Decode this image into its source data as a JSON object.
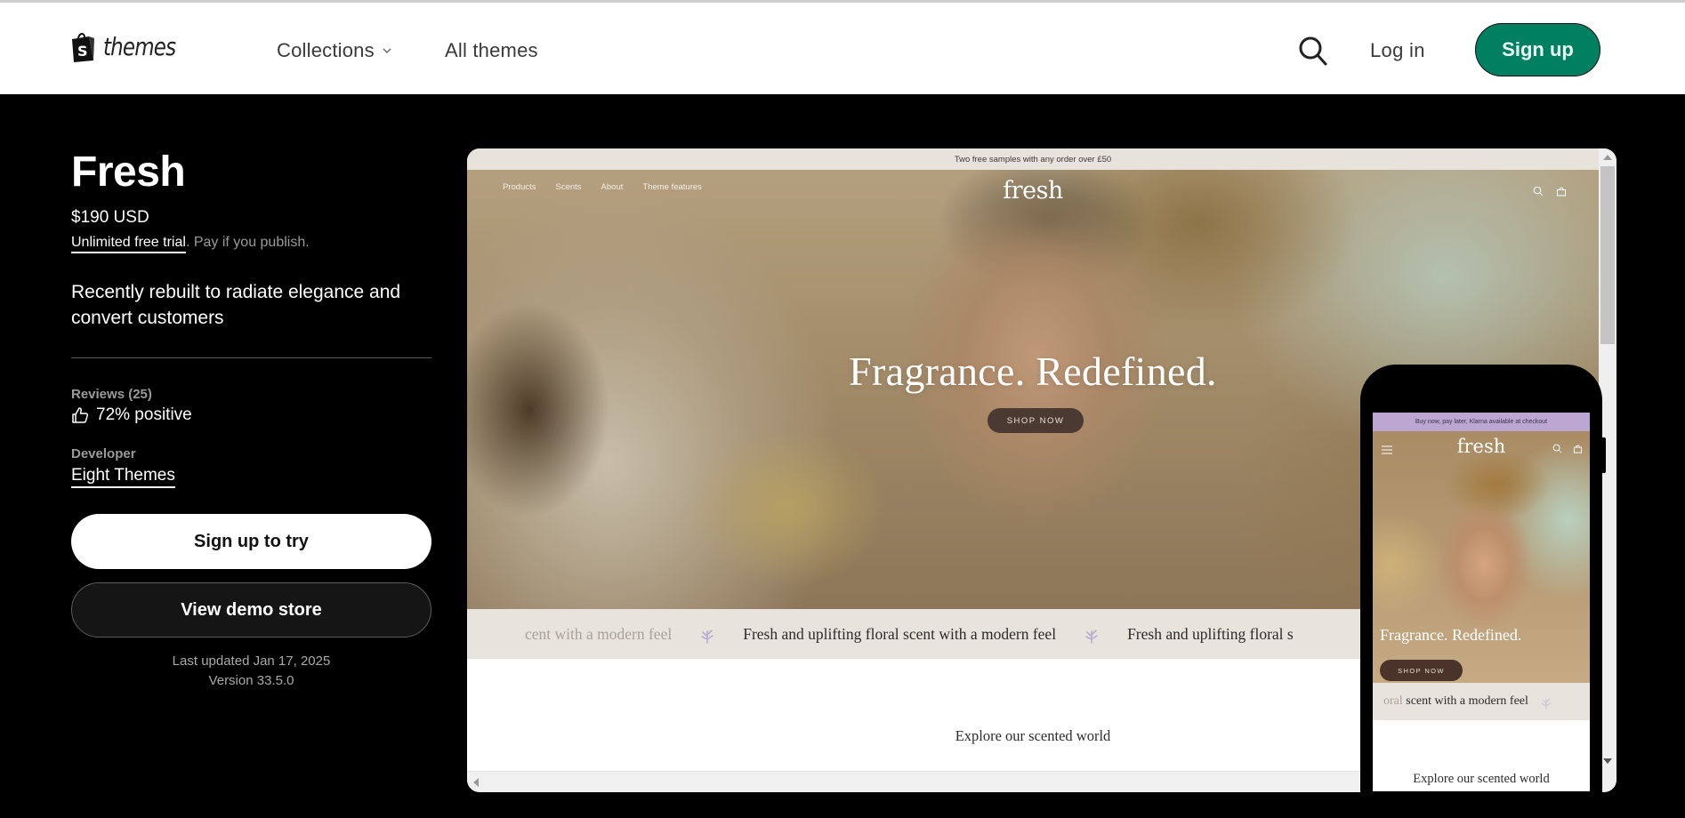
{
  "header": {
    "logo_text": "themes",
    "nav": [
      {
        "label": "Collections",
        "has_dropdown": true
      },
      {
        "label": "All themes",
        "has_dropdown": false
      }
    ],
    "search_icon": "search-icon",
    "login_label": "Log in",
    "signup_label": "Sign up",
    "signup_color": "#008060"
  },
  "theme": {
    "name": "Fresh",
    "price": "$190 USD",
    "trial_link": "Unlimited free trial",
    "trial_note": ". Pay if you publish.",
    "tagline": "Recently rebuilt to radiate elegance and convert customers",
    "reviews_label": "Reviews (25)",
    "reviews_value": "72% positive",
    "developer_label": "Developer",
    "developer_name": "Eight Themes",
    "try_button": "Sign up to try",
    "demo_button": "View demo store",
    "last_updated": "Last updated Jan 17, 2025",
    "version": "Version 33.5.0"
  },
  "desktop_preview": {
    "announcement": "Two free samples with any order over £50",
    "nav": [
      "Products",
      "Scents",
      "About",
      "Theme features"
    ],
    "logo": "fresh",
    "hero_title": "Fragrance. Redefined.",
    "hero_button": "SHOP NOW",
    "marquee_faded": "cent with a modern feel",
    "marquee_text": "Fresh and uplifting floral scent with a modern feel",
    "marquee_partial": "Fresh and uplifting floral s",
    "section_heading": "Explore our scented world"
  },
  "mobile_preview": {
    "announcement": "Buy now, pay later, Klarna available at checkout",
    "logo": "fresh",
    "hero_title": "Fragrance. Redefined.",
    "hero_button": "SHOP NOW",
    "marquee_faded": "oral",
    "marquee_text": "scent with a modern feel",
    "section_heading": "Explore our scented world"
  }
}
